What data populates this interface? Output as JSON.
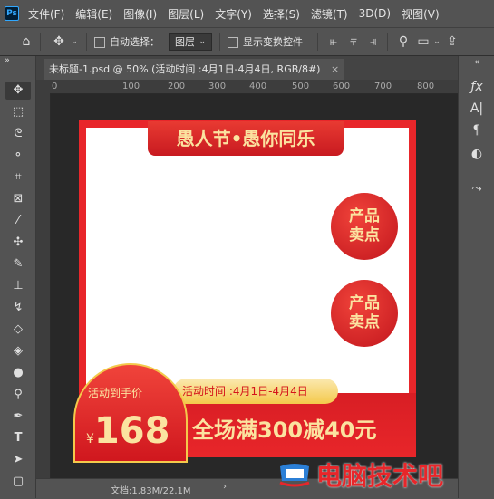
{
  "app": {
    "logo": "Ps"
  },
  "menu": [
    "文件(F)",
    "编辑(E)",
    "图像(I)",
    "图层(L)",
    "文字(Y)",
    "选择(S)",
    "滤镜(T)",
    "3D(D)",
    "视图(V)"
  ],
  "options": {
    "auto_select_label": "自动选择：",
    "layer_dropdown": "图层",
    "show_transform_label": "显示变换控件"
  },
  "document": {
    "tab_title": "未标题-1.psd @ 50% (活动时间 :4月1日-4月4日, RGB/8#)",
    "close_glyph": "×"
  },
  "ruler": {
    "top_labels": [
      "0",
      "100",
      "200",
      "300",
      "400",
      "500",
      "600",
      "700",
      "800"
    ]
  },
  "status": {
    "doc_size": "文档:1.83M/22.1M"
  },
  "design": {
    "title": "愚人节•愚你同乐",
    "feature_1": [
      "产品",
      "卖点"
    ],
    "feature_2": [
      "产品",
      "卖点"
    ],
    "badge_label": "活动到手价",
    "currency": "¥",
    "price": "168",
    "time_label": "活动时间 :4月1日-4月4日",
    "promo": "全场满300减40元"
  },
  "watermark": {
    "text": "电脑技术吧"
  },
  "colors": {
    "accent_red": "#e8262a",
    "gold": "#f4c94b",
    "ps_blue": "#31a8ff"
  }
}
